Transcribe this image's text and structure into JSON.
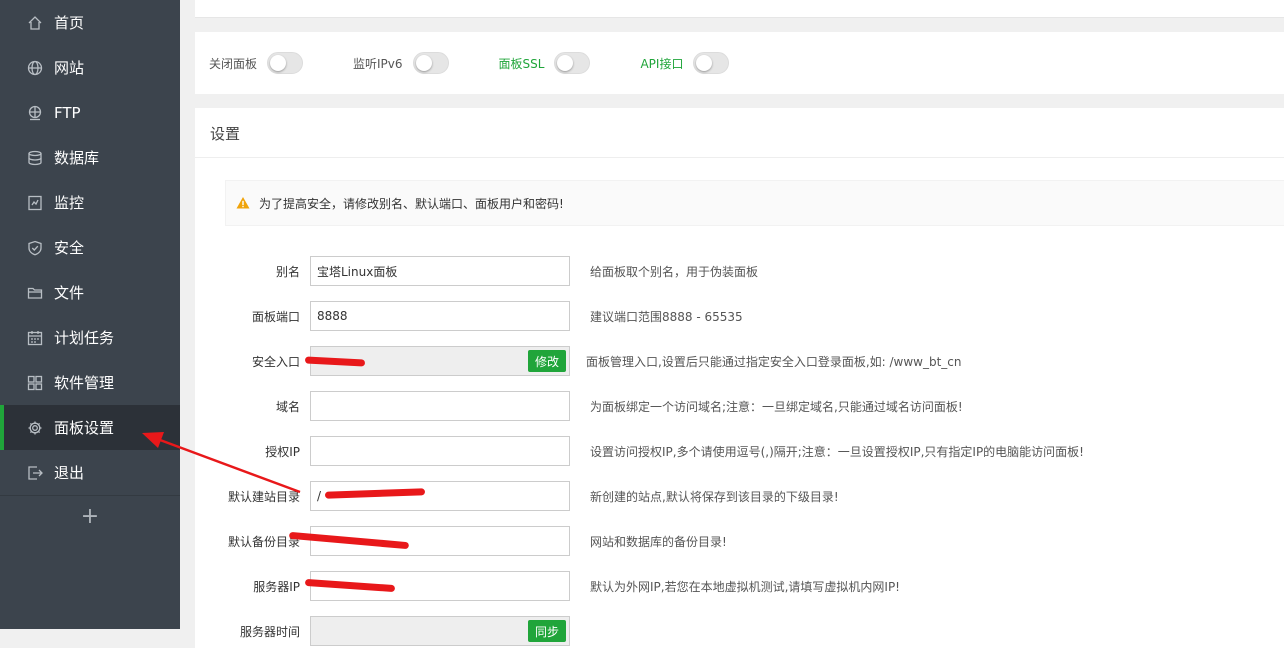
{
  "sidebar": {
    "items": [
      {
        "label": "首页",
        "icon": "home-icon"
      },
      {
        "label": "网站",
        "icon": "globe-icon"
      },
      {
        "label": "FTP",
        "icon": "ftp-icon"
      },
      {
        "label": "数据库",
        "icon": "database-icon"
      },
      {
        "label": "监控",
        "icon": "monitor-icon"
      },
      {
        "label": "安全",
        "icon": "shield-icon"
      },
      {
        "label": "文件",
        "icon": "folder-icon"
      },
      {
        "label": "计划任务",
        "icon": "calendar-icon"
      },
      {
        "label": "软件管理",
        "icon": "apps-icon"
      },
      {
        "label": "面板设置",
        "icon": "gear-icon",
        "active": true
      },
      {
        "label": "退出",
        "icon": "logout-icon"
      }
    ],
    "add_label": "+"
  },
  "switches": [
    {
      "label": "关闭面板",
      "on": false
    },
    {
      "label": "监听IPv6",
      "on": false
    },
    {
      "label": "面板SSL",
      "on": false,
      "accent": true
    },
    {
      "label": "API接口",
      "on": false,
      "accent": true
    }
  ],
  "settings": {
    "title": "设置",
    "warning": "为了提高安全，请修改别名、默认端口、面板用户和密码!",
    "fields": [
      {
        "label": "别名",
        "value": "宝塔Linux面板",
        "hint": "给面板取个别名，用于伪装面板"
      },
      {
        "label": "面板端口",
        "value": "8888",
        "hint": "建议端口范围8888 - 65535"
      },
      {
        "label": "安全入口",
        "value": "",
        "hint": "面板管理入口,设置后只能通过指定安全入口登录面板,如: /www_bt_cn",
        "button": "修改",
        "disabled": true
      },
      {
        "label": "域名",
        "value": "",
        "hint": "为面板绑定一个访问域名;注意：一旦绑定域名,只能通过域名访问面板!"
      },
      {
        "label": "授权IP",
        "value": "",
        "hint": "设置访问授权IP,多个请使用逗号(,)隔开;注意：一旦设置授权IP,只有指定IP的电脑能访问面板!"
      },
      {
        "label": "默认建站目录",
        "value": "/",
        "hint": "新创建的站点,默认将保存到该目录的下级目录!"
      },
      {
        "label": "默认备份目录",
        "value": "",
        "hint": "网站和数据库的备份目录!"
      },
      {
        "label": "服务器IP",
        "value": "",
        "hint": "默认为外网IP,若您在本地虚拟机测试,请填写虚拟机内网IP!"
      },
      {
        "label": "服务器时间",
        "value": "",
        "hint": "",
        "button": "同步",
        "disabled": true
      }
    ]
  },
  "colors": {
    "accent": "#20a53a",
    "sidebar_bg": "#3c444d",
    "annotation": "#e8181a"
  }
}
